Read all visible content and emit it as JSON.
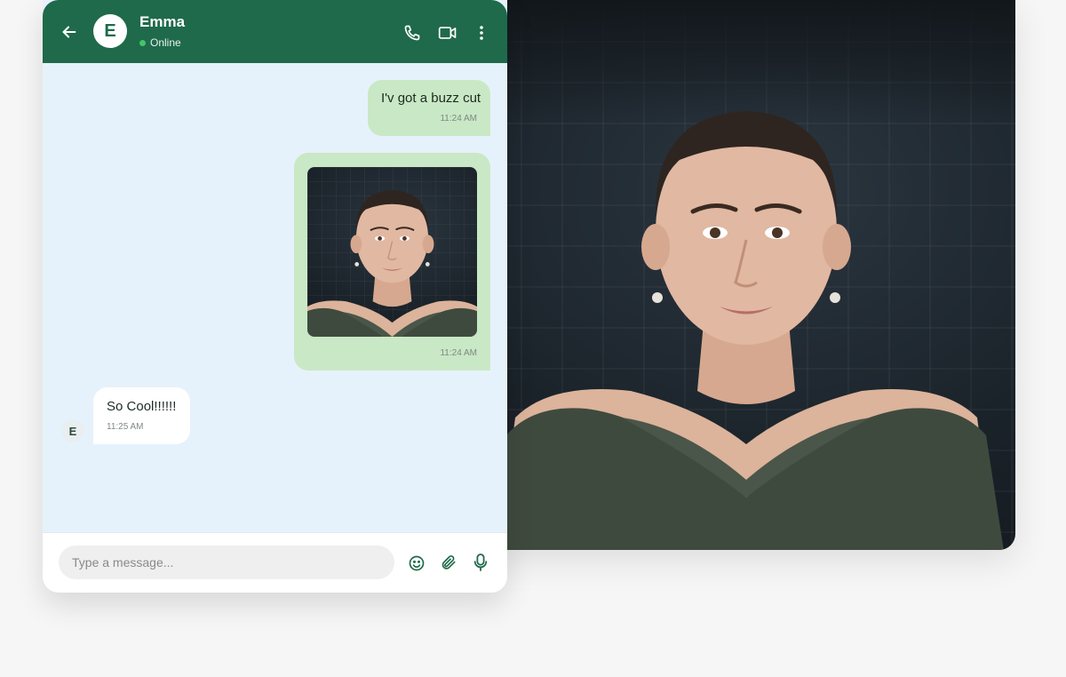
{
  "colors": {
    "header_bg": "#1f6a4b",
    "chat_bg": "#e6f2fb",
    "outgoing_bubble": "#c9e8c5",
    "incoming_bubble": "#ffffff",
    "online_dot": "#41c56b",
    "accent_icon": "#1f6a4b"
  },
  "header": {
    "back_icon": "arrow-left-icon",
    "avatar_initial": "E",
    "contact_name": "Emma",
    "status": "Online",
    "actions": [
      "phone-icon",
      "video-camera-icon",
      "more-vertical-icon"
    ]
  },
  "messages": [
    {
      "direction": "outgoing",
      "type": "text",
      "text": "I'v got a buzz cut",
      "time": "11:24 AM"
    },
    {
      "direction": "outgoing",
      "type": "image",
      "time": "11:24 AM"
    },
    {
      "direction": "incoming",
      "type": "text",
      "text": "So Cool!!!!!!",
      "time": "11:25 AM",
      "avatar_initial": "E"
    }
  ],
  "composer": {
    "placeholder": "Type a message...",
    "value": "",
    "icons": [
      "emoji-icon",
      "paperclip-icon",
      "microphone-icon"
    ]
  }
}
